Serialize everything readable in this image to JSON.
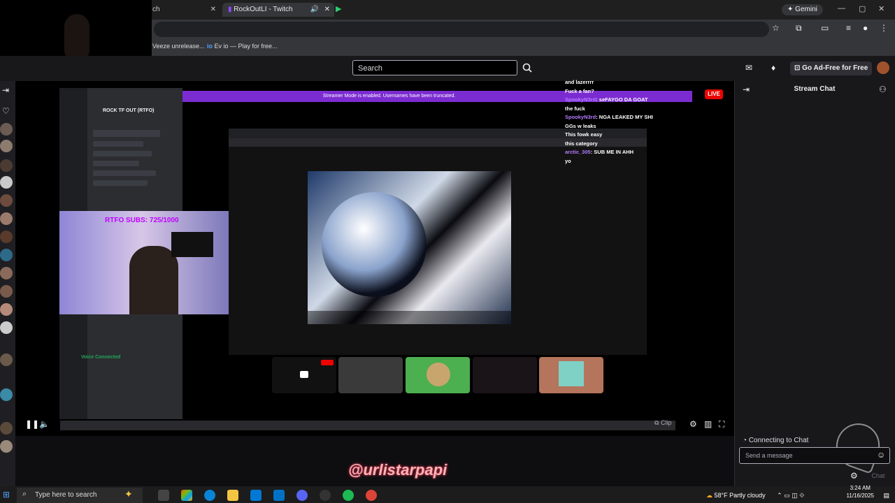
{
  "browser": {
    "tabs": [
      {
        "title": "ch",
        "active": false
      },
      {
        "title": "RockOutLI - Twitch",
        "active": true
      }
    ],
    "gemini_label": "Gemini",
    "bookmarks": [
      {
        "label": "Veeze unrelease..."
      },
      {
        "label": "Ev io — Play for free..."
      }
    ]
  },
  "twitch": {
    "search_placeholder": "Search",
    "ad_free_label": "Go Ad-Free for Free",
    "live_label": "LIVE",
    "stream_chat_title": "Stream Chat",
    "connecting_text": "Connecting to Chat",
    "send_placeholder": "Send a message",
    "chat_button": "Chat",
    "clip_label": "Clip",
    "watermark": "@urlistarpapi"
  },
  "stream_content": {
    "discord_server": "ROCK TF OUT (RTFO)",
    "sub_goal": "RTFO SUBS: 725/1000",
    "voice_connected": "Voice Connected",
    "chat_overlay": [
      {
        "user": "",
        "msg": "and lazerrrr"
      },
      {
        "user": "",
        "msg": "Fuck a fan?"
      },
      {
        "user": "SpookyN3rd",
        "msg": "seFAYGO DA GOAT"
      },
      {
        "user": "",
        "msg": "the fuck"
      },
      {
        "user": "SpookyN3rd",
        "msg": "NGA LEAKED MY SHI"
      },
      {
        "user": "",
        "msg": "GGs w leaks"
      },
      {
        "user": "",
        "msg": "This fowk easy"
      },
      {
        "user": "",
        "msg": "this category"
      },
      {
        "user": "arctic_305",
        "msg": "SUB ME IN AHH"
      },
      {
        "user": "",
        "msg": "yo"
      }
    ]
  },
  "taskbar": {
    "search_placeholder": "Type here to search",
    "weather": "58°F  Partly cloudy",
    "time": "3:24 AM",
    "date": "11/16/2025"
  },
  "colors": {
    "twitch_purple": "#9147ff",
    "live_red": "#eb0400",
    "bg_dark": "#0e0e10"
  }
}
